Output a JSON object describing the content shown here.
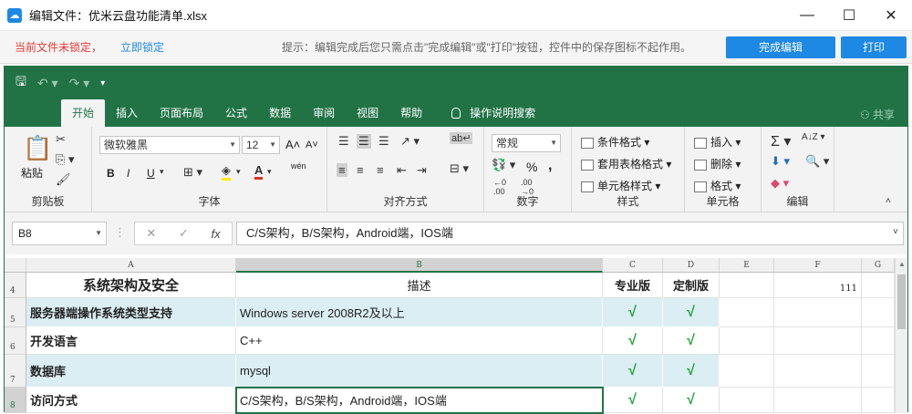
{
  "window": {
    "icon": "cloud-icon",
    "title": "编辑文件：优米云盘功能清单.xlsx",
    "minimize": "—",
    "maximize": "☐",
    "close": "✕"
  },
  "notice": {
    "warning": "当前文件未锁定，",
    "lock_link": "立即锁定",
    "tip": "提示：编辑完成后您只需点击\"完成编辑\"或\"打印\"按钮，控件中的保存图标不起作用。",
    "finish_button": "完成编辑",
    "print_button": "打印"
  },
  "excel": {
    "tabs": [
      "开始",
      "插入",
      "页面布局",
      "公式",
      "数据",
      "审阅",
      "视图",
      "帮助"
    ],
    "search_label": "操作说明搜索",
    "share_label": "共享",
    "clipboard": {
      "paste": "粘贴",
      "label": "剪贴板"
    },
    "font": {
      "name": "微软雅黑",
      "size": "12",
      "label": "字体",
      "bold": "B",
      "italic": "I",
      "underline": "U",
      "grow": "A",
      "shrink": "A",
      "wen": "wén"
    },
    "alignment": {
      "label": "对齐方式"
    },
    "number": {
      "format": "常规",
      "label": "数字",
      "percent": "%",
      "comma": ","
    },
    "styles": {
      "conditional": "条件格式",
      "table": "套用表格格式",
      "cell": "单元格样式",
      "label": "样式"
    },
    "cells": {
      "insert": "插入",
      "delete": "删除",
      "format": "格式",
      "label": "单元格"
    },
    "editing": {
      "label": "编辑"
    },
    "accent": "#217346"
  },
  "formula_bar": {
    "name_box": "B8",
    "formula": "C/S架构，B/S架构，Android端，IOS端"
  },
  "sheet": {
    "columns": [
      "A",
      "B",
      "C",
      "D",
      "E",
      "F",
      "G"
    ],
    "rows": [
      "4",
      "5",
      "6",
      "7",
      "8"
    ],
    "header": {
      "a": "系统架构及安全",
      "b": "描述",
      "c": "专业版",
      "d": "定制版",
      "f": "111"
    },
    "data": [
      {
        "a": "服务器端操作系统类型支持",
        "b": "Windows server 2008R2及以上",
        "c": "√",
        "d": "√"
      },
      {
        "a": "开发语言",
        "b": "C++",
        "c": "√",
        "d": "√"
      },
      {
        "a": "数据库",
        "b": "mysql",
        "c": "√",
        "d": "√"
      },
      {
        "a": "访问方式",
        "b": "C/S架构，B/S架构，Android端，IOS端",
        "c": "√",
        "d": "√"
      }
    ]
  }
}
